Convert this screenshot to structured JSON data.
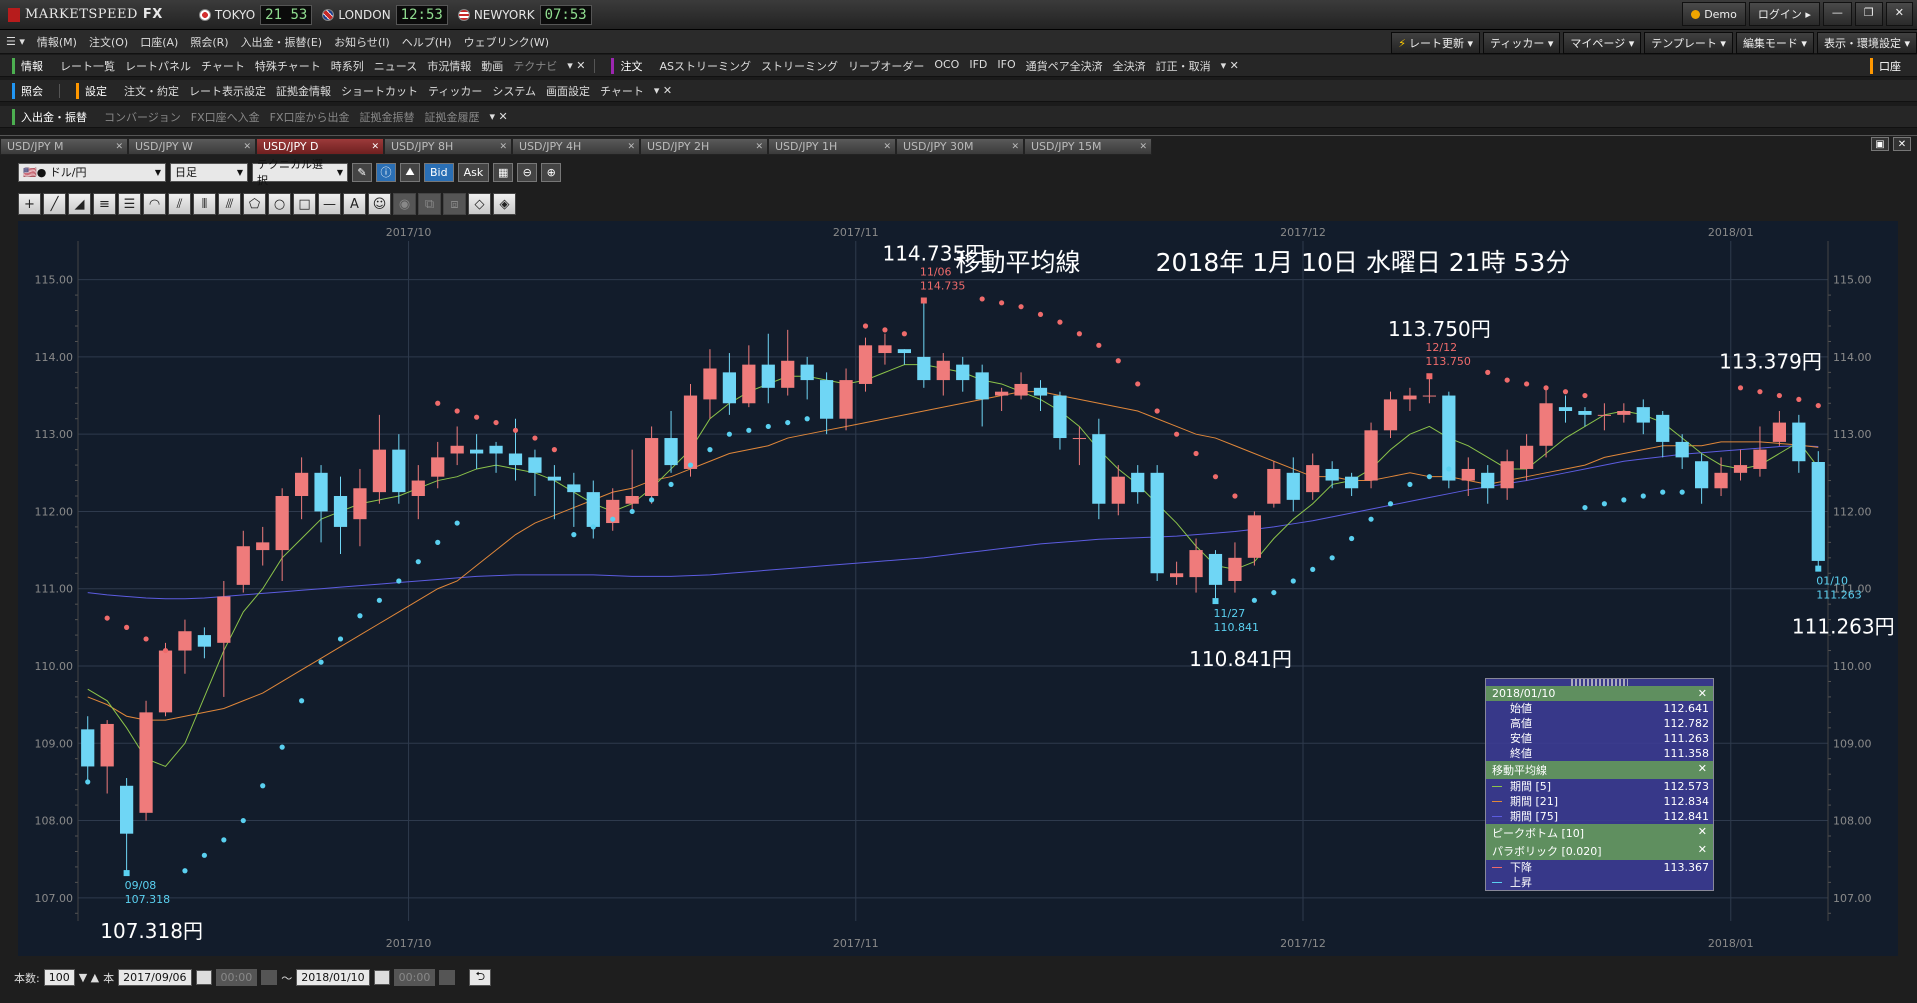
{
  "app": {
    "logo_text": "MARKETSPEED",
    "logo_fx": "FX",
    "clocks": [
      {
        "city": "TOKYO",
        "time": "21 53",
        "flag": "jp"
      },
      {
        "city": "LONDON",
        "time": "12:53",
        "flag": "uk"
      },
      {
        "city": "NEWYORK",
        "time": "07:53",
        "flag": "us"
      }
    ],
    "demo_label": "Demo",
    "login_label": "ログイン"
  },
  "menubar": {
    "items": [
      "情報(M)",
      "注文(O)",
      "口座(A)",
      "照会(R)",
      "入出金・振替(E)",
      "お知らせ(I)",
      "ヘルプ(H)",
      "ウェブリンク(W)"
    ],
    "right": [
      "レート更新",
      "ティッカー",
      "マイページ",
      "テンプレート",
      "編集モード",
      "表示・環境設定"
    ]
  },
  "toolbar1": {
    "cat1": "情報",
    "items1": [
      "レート一覧",
      "レートパネル",
      "チャート",
      "特殊チャート",
      "時系列",
      "ニュース",
      "市況情報",
      "動画",
      "テクナビ"
    ],
    "cat2": "注文",
    "items2": [
      "ASストリーミング",
      "ストリーミング",
      "リーブオーダー",
      "OCO",
      "IFD",
      "IFO",
      "通貨ペア全決済",
      "全決済",
      "訂正・取消"
    ],
    "right": "口座"
  },
  "toolbar2": {
    "cat1": "照会",
    "cat2": "設定",
    "items2": [
      "注文・約定",
      "レート表示設定",
      "証拠金情報",
      "ショートカット",
      "ティッカー",
      "システム",
      "画面設定",
      "チャート"
    ]
  },
  "toolbar3": {
    "cat1": "入出金・振替",
    "items": [
      "コンバージョン",
      "FX口座へ入金",
      "FX口座から出金",
      "証拠金振替",
      "証拠金履歴"
    ]
  },
  "tabs": [
    "USD/JPY M",
    "USD/JPY W",
    "USD/JPY D",
    "USD/JPY 8H",
    "USD/JPY 4H",
    "USD/JPY 2H",
    "USD/JPY 1H",
    "USD/JPY 30M",
    "USD/JPY 15M"
  ],
  "active_tab": 2,
  "controls": {
    "pair": "ドル/円",
    "period": "日足",
    "technical": "テクニカル選択",
    "bid": "Bid",
    "ask": "Ask"
  },
  "footer": {
    "count_label": "本数:",
    "count_value": "100",
    "count_unit": "本",
    "from_date": "2017/09/06",
    "from_time": "00:00",
    "tilde": "〜",
    "to_date": "2018/01/10",
    "to_time": "00:00"
  },
  "chart_header": {
    "title": "移動平均線",
    "datetime": "2018年 1月 10日 水曜日 21時 53分"
  },
  "info": {
    "date": "2018/01/10",
    "ohlc": [
      {
        "label": "始値",
        "value": "112.641"
      },
      {
        "label": "高値",
        "value": "112.782"
      },
      {
        "label": "安値",
        "value": "111.263"
      },
      {
        "label": "終値",
        "value": "111.358"
      }
    ],
    "ma_header": "移動平均線",
    "ma": [
      {
        "label": "期間 [5]",
        "value": "112.573",
        "color": "#8bc34a"
      },
      {
        "label": "期間 [21]",
        "value": "112.834",
        "color": "#e0873a"
      },
      {
        "label": "期間 [75]",
        "value": "112.841",
        "color": "#5c5ce0"
      }
    ],
    "peak_header": "ピークボトム [10]",
    "sar_header": "パラボリック [0.020]",
    "sar": [
      {
        "label": "下降",
        "value": "113.367",
        "color": "#ef6b6b"
      },
      {
        "label": "上昇",
        "value": "",
        "color": "#5ad0f0"
      }
    ]
  },
  "chart_data": {
    "type": "candlestick",
    "pair": "USD/JPY",
    "timeframe": "D",
    "ylim": [
      106.7,
      115.5
    ],
    "y_ticks": [
      "115.00",
      "114.00",
      "113.00",
      "112.00",
      "111.00",
      "110.00",
      "109.00",
      "108.00",
      "107.00"
    ],
    "month_labels": [
      {
        "label": "2017/10",
        "index": 17
      },
      {
        "label": "2017/11",
        "index": 40
      },
      {
        "label": "2017/12",
        "index": 63
      },
      {
        "label": "2018/01",
        "index": 85
      }
    ],
    "candles": [
      [
        109.18,
        108.7,
        109.35,
        108.5
      ],
      [
        108.7,
        109.25,
        109.3,
        108.35
      ],
      [
        108.45,
        107.83,
        108.55,
        107.32
      ],
      [
        108.1,
        109.4,
        109.55,
        108.0
      ],
      [
        109.4,
        110.2,
        110.3,
        109.35
      ],
      [
        110.2,
        110.45,
        110.6,
        109.9
      ],
      [
        110.4,
        110.25,
        110.5,
        110.1
      ],
      [
        110.3,
        110.9,
        111.1,
        109.6
      ],
      [
        111.05,
        111.55,
        111.75,
        110.95
      ],
      [
        111.5,
        111.6,
        111.8,
        111.3
      ],
      [
        111.5,
        112.2,
        112.3,
        111.1
      ],
      [
        112.2,
        112.5,
        112.7,
        111.9
      ],
      [
        112.5,
        112.0,
        112.6,
        111.6
      ],
      [
        112.2,
        111.8,
        112.45,
        111.45
      ],
      [
        111.9,
        112.3,
        112.55,
        111.55
      ],
      [
        112.25,
        112.8,
        113.25,
        112.1
      ],
      [
        112.8,
        112.25,
        113.0,
        112.1
      ],
      [
        112.2,
        112.4,
        112.6,
        111.9
      ],
      [
        112.45,
        112.7,
        112.9,
        112.3
      ],
      [
        112.75,
        112.85,
        113.1,
        112.6
      ],
      [
        112.8,
        112.75,
        113.0,
        112.55
      ],
      [
        112.85,
        112.75,
        112.9,
        112.5
      ],
      [
        112.75,
        112.6,
        113.2,
        112.4
      ],
      [
        112.7,
        112.5,
        112.8,
        112.2
      ],
      [
        112.45,
        112.4,
        112.6,
        111.9
      ],
      [
        112.35,
        112.25,
        112.5,
        111.8
      ],
      [
        112.25,
        111.8,
        112.4,
        111.65
      ],
      [
        111.85,
        112.15,
        112.3,
        111.75
      ],
      [
        112.1,
        112.2,
        112.8,
        112.0
      ],
      [
        112.2,
        112.95,
        113.1,
        112.1
      ],
      [
        112.95,
        112.6,
        113.3,
        112.5
      ],
      [
        112.55,
        113.5,
        113.65,
        112.45
      ],
      [
        113.45,
        113.85,
        114.1,
        113.2
      ],
      [
        113.8,
        113.4,
        114.05,
        113.25
      ],
      [
        113.4,
        113.9,
        114.15,
        113.35
      ],
      [
        113.9,
        113.6,
        114.3,
        113.4
      ],
      [
        113.6,
        113.95,
        114.35,
        113.5
      ],
      [
        113.9,
        113.7,
        114.0,
        113.45
      ],
      [
        113.7,
        113.2,
        113.8,
        113.0
      ],
      [
        113.2,
        113.7,
        113.85,
        113.05
      ],
      [
        113.65,
        114.15,
        114.25,
        113.55
      ],
      [
        114.05,
        114.15,
        114.3,
        113.9
      ],
      [
        114.1,
        114.05,
        114.1,
        113.9
      ],
      [
        114.0,
        113.7,
        114.73,
        113.6
      ],
      [
        113.7,
        113.95,
        114.05,
        113.5
      ],
      [
        113.9,
        113.7,
        114.0,
        113.55
      ],
      [
        113.8,
        113.45,
        113.9,
        113.1
      ],
      [
        113.5,
        113.55,
        113.6,
        113.3
      ],
      [
        113.5,
        113.65,
        113.8,
        113.45
      ],
      [
        113.6,
        113.5,
        113.7,
        113.3
      ],
      [
        113.5,
        112.95,
        113.55,
        112.8
      ],
      [
        112.95,
        112.95,
        113.1,
        112.6
      ],
      [
        113.0,
        112.1,
        113.2,
        111.9
      ],
      [
        112.1,
        112.45,
        112.6,
        111.95
      ],
      [
        112.5,
        112.25,
        112.6,
        112.1
      ],
      [
        112.5,
        111.2,
        112.6,
        111.1
      ],
      [
        111.15,
        111.2,
        111.35,
        111.05
      ],
      [
        111.15,
        111.5,
        111.65,
        110.95
      ],
      [
        111.45,
        111.05,
        111.5,
        110.84
      ],
      [
        111.1,
        111.4,
        111.6,
        110.95
      ],
      [
        111.4,
        111.95,
        112.0,
        111.3
      ],
      [
        112.1,
        112.55,
        112.65,
        112.05
      ],
      [
        112.5,
        112.15,
        112.7,
        112.0
      ],
      [
        112.25,
        112.6,
        112.75,
        112.15
      ],
      [
        112.55,
        112.4,
        112.65,
        112.3
      ],
      [
        112.45,
        112.3,
        112.5,
        112.2
      ],
      [
        112.4,
        113.05,
        113.15,
        112.3
      ],
      [
        113.05,
        113.45,
        113.55,
        112.95
      ],
      [
        113.45,
        113.5,
        113.6,
        113.3
      ],
      [
        113.5,
        113.5,
        113.75,
        113.4
      ],
      [
        113.5,
        112.4,
        113.55,
        112.3
      ],
      [
        112.4,
        112.55,
        112.7,
        112.2
      ],
      [
        112.5,
        112.3,
        112.6,
        112.1
      ],
      [
        112.3,
        112.65,
        112.8,
        112.15
      ],
      [
        112.55,
        112.85,
        113.0,
        112.4
      ],
      [
        112.85,
        113.4,
        113.6,
        112.7
      ],
      [
        113.35,
        113.3,
        113.5,
        113.15
      ],
      [
        113.3,
        113.25,
        113.35,
        113.1
      ],
      [
        113.25,
        113.25,
        113.4,
        113.05
      ],
      [
        113.25,
        113.3,
        113.4,
        113.15
      ],
      [
        113.35,
        113.15,
        113.45,
        113.0
      ],
      [
        113.25,
        112.9,
        113.3,
        112.7
      ],
      [
        112.9,
        112.7,
        113.0,
        112.55
      ],
      [
        112.65,
        112.3,
        112.75,
        112.1
      ],
      [
        112.3,
        112.5,
        112.7,
        112.2
      ],
      [
        112.5,
        112.6,
        112.8,
        112.4
      ],
      [
        112.55,
        112.8,
        113.1,
        112.45
      ],
      [
        112.9,
        113.15,
        113.3,
        112.85
      ],
      [
        113.15,
        112.65,
        113.25,
        112.5
      ],
      [
        112.64,
        111.36,
        112.78,
        111.26
      ]
    ],
    "sar_down": [
      [
        1,
        110.62
      ],
      [
        2,
        110.5
      ],
      [
        3,
        110.35
      ],
      [
        4,
        110.2
      ],
      [
        18,
        113.4
      ],
      [
        19,
        113.3
      ],
      [
        20,
        113.22
      ],
      [
        21,
        113.15
      ],
      [
        22,
        113.05
      ],
      [
        23,
        112.95
      ],
      [
        24,
        112.8
      ],
      [
        40,
        114.4
      ],
      [
        41,
        114.35
      ],
      [
        42,
        114.3
      ],
      [
        46,
        114.75
      ],
      [
        47,
        114.7
      ],
      [
        48,
        114.65
      ],
      [
        49,
        114.55
      ],
      [
        50,
        114.45
      ],
      [
        51,
        114.3
      ],
      [
        52,
        114.15
      ],
      [
        53,
        113.95
      ],
      [
        54,
        113.65
      ],
      [
        55,
        113.3
      ],
      [
        56,
        113.0
      ],
      [
        57,
        112.75
      ],
      [
        58,
        112.45
      ],
      [
        59,
        112.2
      ],
      [
        72,
        113.8
      ],
      [
        73,
        113.7
      ],
      [
        74,
        113.65
      ],
      [
        75,
        113.6
      ],
      [
        76,
        113.55
      ],
      [
        77,
        113.5
      ],
      [
        85,
        113.6
      ],
      [
        86,
        113.55
      ],
      [
        87,
        113.5
      ],
      [
        88,
        113.45
      ],
      [
        89,
        113.37
      ]
    ],
    "sar_up": [
      [
        0,
        108.5
      ],
      [
        5,
        107.35
      ],
      [
        6,
        107.55
      ],
      [
        7,
        107.75
      ],
      [
        8,
        108.0
      ],
      [
        9,
        108.45
      ],
      [
        10,
        108.95
      ],
      [
        11,
        109.55
      ],
      [
        12,
        110.05
      ],
      [
        13,
        110.35
      ],
      [
        14,
        110.65
      ],
      [
        15,
        110.85
      ],
      [
        16,
        111.1
      ],
      [
        17,
        111.35
      ],
      [
        18,
        111.6
      ],
      [
        19,
        111.85
      ],
      [
        25,
        111.7
      ],
      [
        26,
        111.8
      ],
      [
        27,
        111.9
      ],
      [
        28,
        112.0
      ],
      [
        29,
        112.15
      ],
      [
        30,
        112.35
      ],
      [
        31,
        112.6
      ],
      [
        32,
        112.8
      ],
      [
        33,
        113.0
      ],
      [
        34,
        113.05
      ],
      [
        35,
        113.1
      ],
      [
        36,
        113.15
      ],
      [
        37,
        113.2
      ],
      [
        60,
        110.85
      ],
      [
        61,
        110.95
      ],
      [
        62,
        111.1
      ],
      [
        63,
        111.25
      ],
      [
        64,
        111.4
      ],
      [
        65,
        111.65
      ],
      [
        66,
        111.9
      ],
      [
        67,
        112.1
      ],
      [
        68,
        112.35
      ],
      [
        69,
        112.45
      ],
      [
        70,
        112.55
      ],
      [
        77,
        112.05
      ],
      [
        78,
        112.1
      ],
      [
        79,
        112.15
      ],
      [
        80,
        112.2
      ],
      [
        81,
        112.25
      ],
      [
        82,
        112.25
      ]
    ],
    "ma5": [
      109.7,
      109.55,
      109.2,
      108.8,
      108.7,
      109.0,
      109.6,
      110.2,
      110.7,
      111.0,
      111.4,
      111.65,
      111.9,
      112.0,
      112.1,
      112.15,
      112.2,
      112.3,
      112.4,
      112.45,
      112.55,
      112.6,
      112.55,
      112.5,
      112.4,
      112.25,
      112.1,
      112.0,
      112.1,
      112.3,
      112.55,
      112.8,
      113.2,
      113.4,
      113.55,
      113.65,
      113.75,
      113.75,
      113.7,
      113.65,
      113.7,
      113.8,
      113.9,
      113.9,
      113.85,
      113.8,
      113.7,
      113.65,
      113.55,
      113.45,
      113.3,
      113.1,
      112.8,
      112.55,
      112.35,
      112.1,
      111.85,
      111.55,
      111.3,
      111.25,
      111.35,
      111.65,
      111.9,
      112.1,
      112.35,
      112.4,
      112.55,
      112.8,
      113.0,
      113.1,
      112.95,
      112.85,
      112.7,
      112.55,
      112.55,
      112.75,
      112.95,
      113.1,
      113.25,
      113.3,
      113.25,
      113.15,
      112.95,
      112.75,
      112.6,
      112.55,
      112.6,
      112.75,
      112.9,
      112.57
    ],
    "ma21": [
      109.6,
      109.5,
      109.35,
      109.3,
      109.3,
      109.35,
      109.4,
      109.45,
      109.55,
      109.65,
      109.8,
      109.95,
      110.1,
      110.25,
      110.4,
      110.55,
      110.7,
      110.85,
      111.0,
      111.1,
      111.3,
      111.5,
      111.7,
      111.85,
      111.95,
      112.05,
      112.15,
      112.25,
      112.3,
      112.4,
      112.45,
      112.55,
      112.65,
      112.75,
      112.8,
      112.85,
      112.95,
      113.0,
      113.05,
      113.1,
      113.15,
      113.2,
      113.25,
      113.3,
      113.35,
      113.4,
      113.45,
      113.5,
      113.55,
      113.55,
      113.5,
      113.45,
      113.4,
      113.35,
      113.3,
      113.2,
      113.1,
      113.0,
      112.95,
      112.85,
      112.75,
      112.65,
      112.55,
      112.45,
      112.45,
      112.4,
      112.4,
      112.45,
      112.5,
      112.45,
      112.45,
      112.4,
      112.35,
      112.4,
      112.45,
      112.5,
      112.55,
      112.6,
      112.7,
      112.75,
      112.8,
      112.85,
      112.85,
      112.85,
      112.9,
      112.9,
      112.9,
      112.88,
      112.86,
      112.83
    ],
    "ma75": [
      110.95,
      110.92,
      110.9,
      110.88,
      110.87,
      110.87,
      110.88,
      110.9,
      110.92,
      110.94,
      110.96,
      110.98,
      111.0,
      111.02,
      111.04,
      111.06,
      111.08,
      111.1,
      111.12,
      111.14,
      111.16,
      111.17,
      111.18,
      111.18,
      111.18,
      111.18,
      111.18,
      111.17,
      111.16,
      111.16,
      111.16,
      111.17,
      111.18,
      111.2,
      111.22,
      111.24,
      111.26,
      111.28,
      111.3,
      111.32,
      111.34,
      111.36,
      111.38,
      111.4,
      111.43,
      111.46,
      111.49,
      111.52,
      111.55,
      111.58,
      111.6,
      111.62,
      111.64,
      111.65,
      111.66,
      111.67,
      111.68,
      111.7,
      111.72,
      111.74,
      111.77,
      111.8,
      111.84,
      111.88,
      111.93,
      111.98,
      112.03,
      112.08,
      112.13,
      112.18,
      112.23,
      112.28,
      112.32,
      112.36,
      112.4,
      112.45,
      112.5,
      112.55,
      112.6,
      112.65,
      112.68,
      112.71,
      112.74,
      112.76,
      112.78,
      112.8,
      112.82,
      112.84,
      112.85,
      112.84
    ],
    "annotations": [
      {
        "type": "high",
        "index": 43,
        "date": "11/06",
        "value": "114.735",
        "big_label": "114.735円"
      },
      {
        "type": "high",
        "index": 69,
        "date": "12/12",
        "value": "113.750",
        "big_label": "113.750円"
      },
      {
        "type": "low",
        "index": 2,
        "date": "09/08",
        "value": "107.318",
        "big_label": "107.318円"
      },
      {
        "type": "low",
        "index": 58,
        "date": "11/27",
        "value": "110.841",
        "big_label": "110.841円"
      },
      {
        "type": "low",
        "index": 89,
        "date": "01/10",
        "value": "111.263",
        "big_label": "111.263円"
      }
    ],
    "extra_label": {
      "index": 85,
      "value": 113.9,
      "text": "113.379円"
    }
  }
}
